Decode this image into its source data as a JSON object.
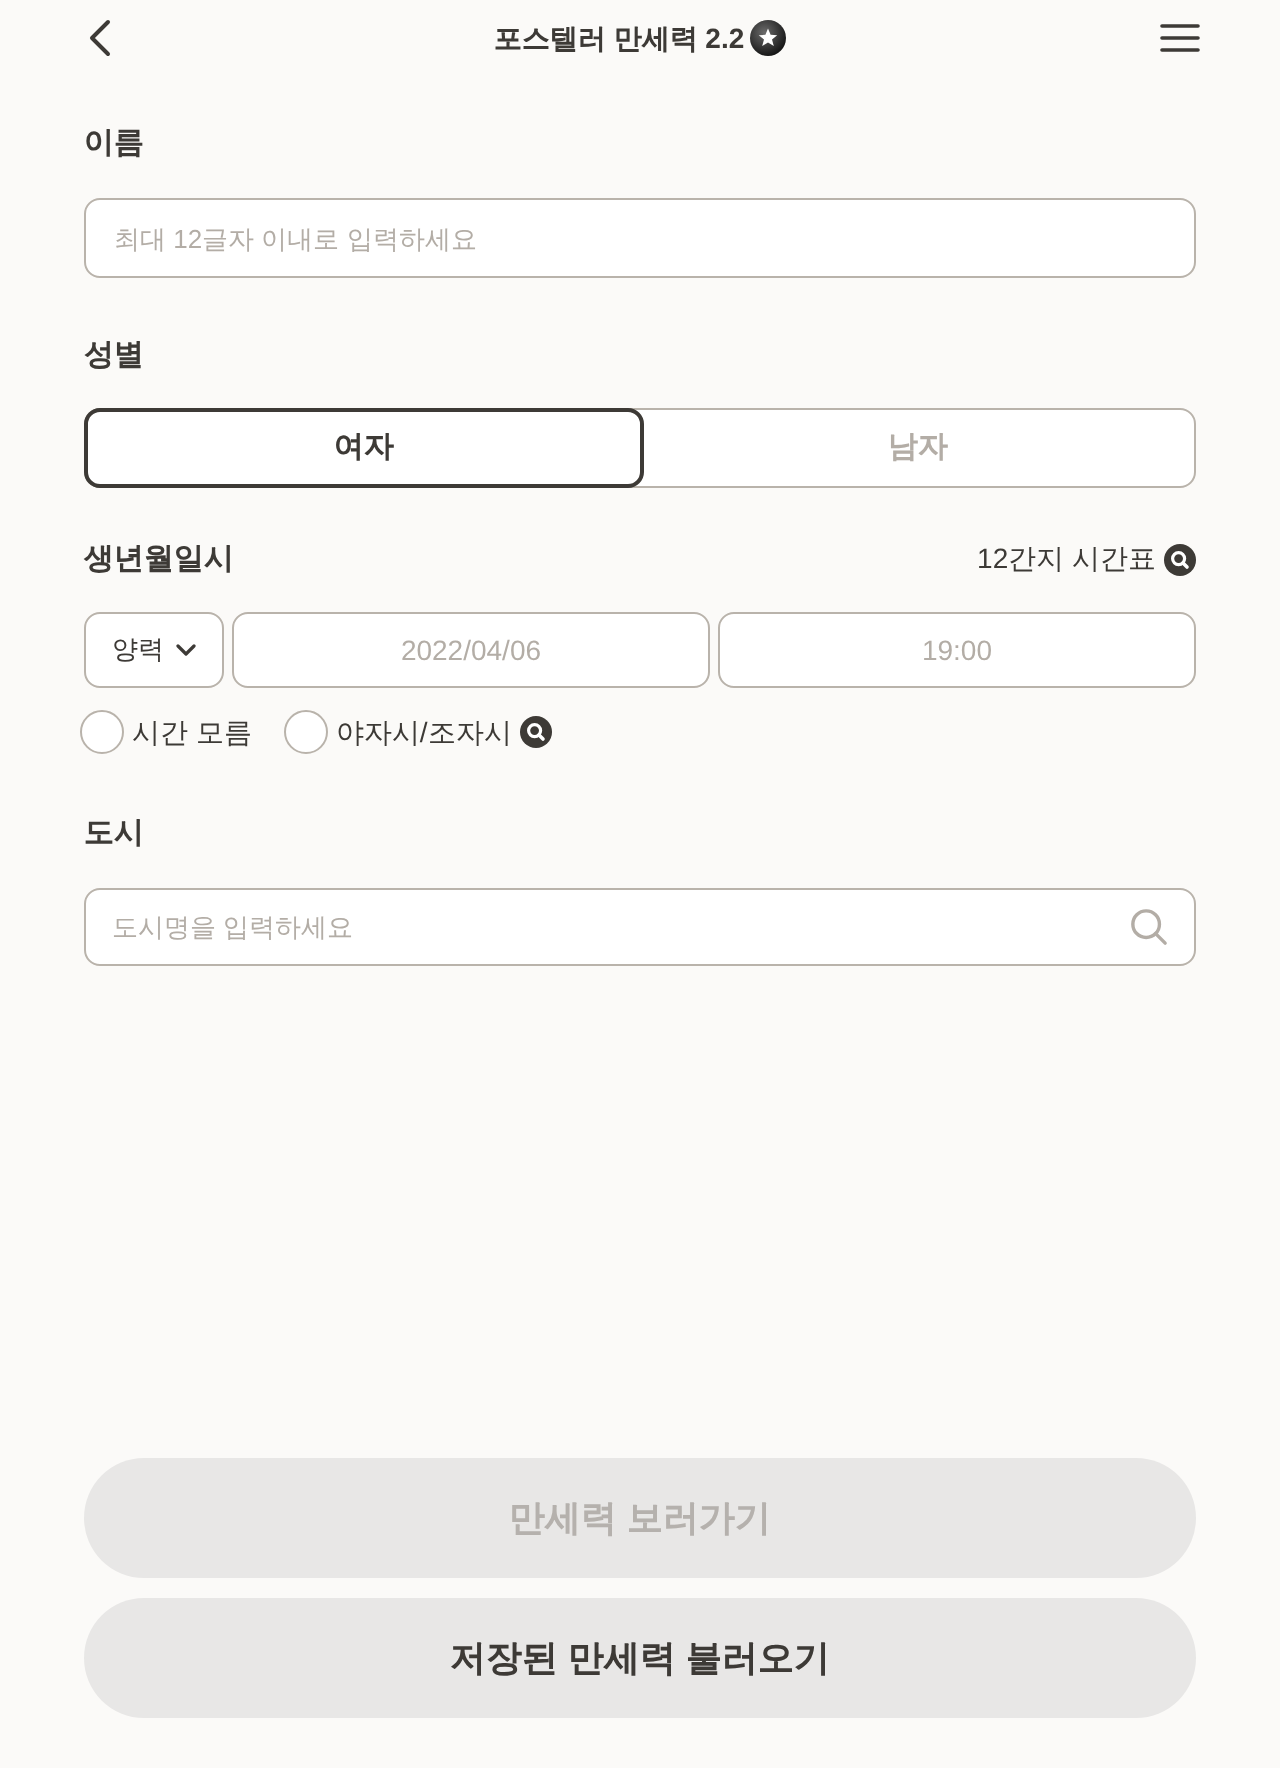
{
  "header": {
    "title": "포스텔러 만세력 2.2"
  },
  "name_field": {
    "label": "이름",
    "placeholder": "최대 12글자 이내로 입력하세요"
  },
  "gender": {
    "label": "성별",
    "options": [
      {
        "label": "여자",
        "selected": true
      },
      {
        "label": "남자",
        "selected": false
      }
    ]
  },
  "birth": {
    "label": "생년월일시",
    "link": "12간지 시간표",
    "calendar": {
      "value": "양력"
    },
    "date": {
      "placeholder": "2022/04/06"
    },
    "time": {
      "placeholder": "19:00"
    },
    "options": [
      {
        "label": "시간 모름",
        "checked": false,
        "help": false
      },
      {
        "label": "야자시/조자시",
        "checked": false,
        "help": true
      }
    ]
  },
  "city": {
    "label": "도시",
    "placeholder": "도시명을 입력하세요"
  },
  "buttons": [
    {
      "label": "만세력 보러가기",
      "disabled": true
    },
    {
      "label": "저장된 만세력 불러오기",
      "disabled": false
    }
  ]
}
